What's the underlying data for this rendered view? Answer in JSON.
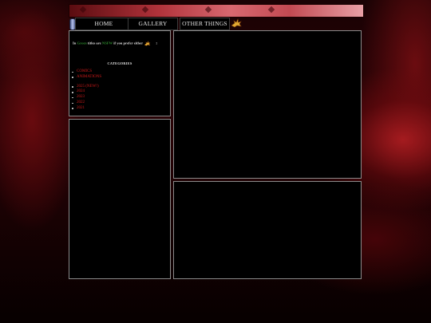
{
  "nav": {
    "home_label": "HOME",
    "gallery_label": "GALLERY",
    "other_label": "OTHER THINGS"
  },
  "hint": {
    "prefix": "In",
    "green_word": "Green",
    "middle": "titles are",
    "nsfw_word": "NSFW",
    "suffix": "if you prefer either",
    "bang": "!"
  },
  "categories": {
    "title": "CATEGORIES",
    "group1": [
      "COMICS",
      "ANIMATIONS"
    ],
    "group2": [
      {
        "year": "2025",
        "note": "(NEW!)"
      },
      {
        "year": "2024",
        "note": ""
      },
      {
        "year": "2023",
        "note": ""
      },
      {
        "year": "2022",
        "note": ""
      },
      {
        "year": "2021",
        "note": ""
      }
    ]
  },
  "colors": {
    "accent_red": "#d11a1a",
    "green": "#2e8b2e",
    "panel_border": "#8a8a8a"
  },
  "icons": [
    "gem-icon",
    "dragon-icon"
  ]
}
